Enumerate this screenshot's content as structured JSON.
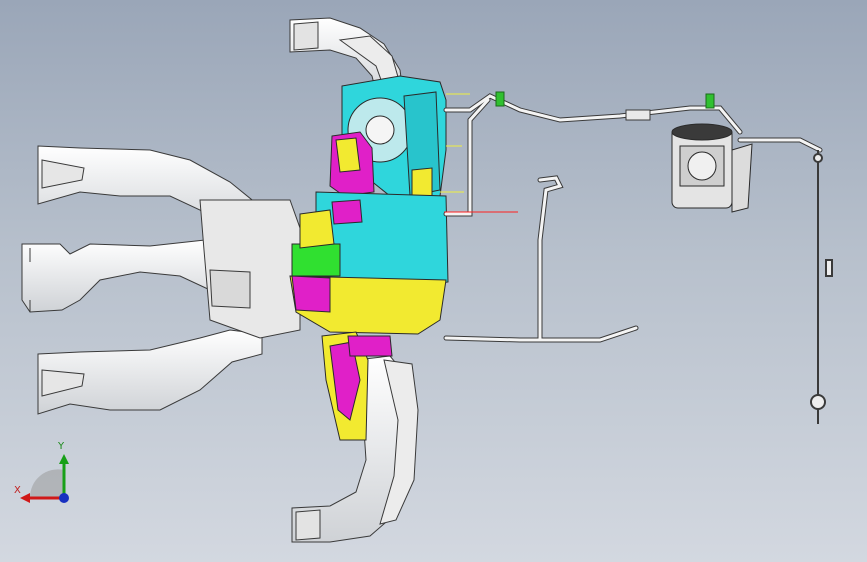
{
  "viewport": {
    "background_top": "#9aa6b8",
    "background_bottom": "#d3d8e0"
  },
  "triad": {
    "x_label": "X",
    "y_label": "Y",
    "x_color": "#d01818",
    "y_color": "#18a018",
    "z_color": "#1830c0"
  },
  "model": {
    "colors": {
      "housing_cyan": "#2fd6dc",
      "housing_yellow": "#f2ea30",
      "housing_magenta": "#e020c8",
      "housing_green": "#30e030",
      "duct_white": "#f2f2f2",
      "edge_dark": "#3a3a3a",
      "leader_red": "#ff2020",
      "leader_yellow": "#f0f040"
    }
  }
}
